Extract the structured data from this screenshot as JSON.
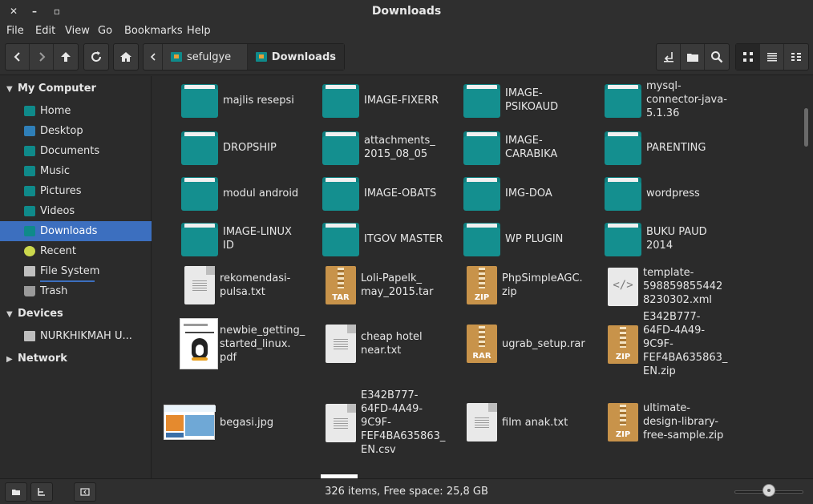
{
  "window": {
    "title": "Downloads"
  },
  "menu": [
    "File",
    "Edit",
    "View",
    "Go",
    "Bookmarks",
    "Help"
  ],
  "breadcrumb": [
    {
      "label": "sefulgye",
      "active": false
    },
    {
      "label": "Downloads",
      "active": true
    }
  ],
  "sidebar": {
    "sections": [
      {
        "label": "My Computer",
        "expanded": true
      },
      {
        "label": "Devices",
        "expanded": true
      },
      {
        "label": "Network",
        "expanded": false
      }
    ],
    "items": [
      {
        "label": "Home",
        "icon": "home-folder-icon"
      },
      {
        "label": "Desktop",
        "icon": "desktop-folder-icon"
      },
      {
        "label": "Documents",
        "icon": "documents-folder-icon"
      },
      {
        "label": "Music",
        "icon": "music-folder-icon"
      },
      {
        "label": "Pictures",
        "icon": "pictures-folder-icon"
      },
      {
        "label": "Videos",
        "icon": "videos-folder-icon"
      },
      {
        "label": "Downloads",
        "icon": "downloads-folder-icon",
        "selected": true
      },
      {
        "label": "Recent",
        "icon": "recent-icon"
      },
      {
        "label": "File System",
        "icon": "drive-icon"
      },
      {
        "label": "Trash",
        "icon": "trash-icon"
      }
    ],
    "devices": [
      {
        "label": "NURKHIKMAH U...",
        "icon": "usb-drive-icon"
      }
    ]
  },
  "files": [
    {
      "name": "majlis resepsi",
      "type": "folder"
    },
    {
      "name": "IMAGE-FIXERR",
      "type": "folder"
    },
    {
      "name": "IMAGE-\nPSIKOAUD",
      "type": "folder"
    },
    {
      "name": "mysql-\nconnector-java-\n5.1.36",
      "type": "folder"
    },
    {
      "name": "DROPSHIP",
      "type": "folder"
    },
    {
      "name": "attachments_\n2015_08_05",
      "type": "folder"
    },
    {
      "name": "IMAGE-\nCARABIKA",
      "type": "folder"
    },
    {
      "name": "PARENTING",
      "type": "folder"
    },
    {
      "name": "modul android",
      "type": "folder"
    },
    {
      "name": "IMAGE-OBATS",
      "type": "folder"
    },
    {
      "name": "IMG-DOA",
      "type": "folder"
    },
    {
      "name": "wordpress",
      "type": "folder"
    },
    {
      "name": "IMAGE-LINUX\nID",
      "type": "folder"
    },
    {
      "name": "ITGOV MASTER",
      "type": "folder"
    },
    {
      "name": "WP PLUGIN",
      "type": "folder"
    },
    {
      "name": "BUKU PAUD\n2014",
      "type": "folder"
    },
    {
      "name": "rekomendasi-\npulsa.txt",
      "type": "text"
    },
    {
      "name": "Loli-Papelk_\nmay_2015.tar",
      "type": "archive",
      "badge": "TAR"
    },
    {
      "name": "PhpSimpleAGC.\nzip",
      "type": "archive",
      "badge": "ZIP"
    },
    {
      "name": "template-\n598859855442\n8230302.xml",
      "type": "xml"
    },
    {
      "name": "newbie_getting_\nstarted_linux.\npdf",
      "type": "pdf"
    },
    {
      "name": "cheap hotel\nnear.txt",
      "type": "text"
    },
    {
      "name": "ugrab_setup.rar",
      "type": "archive",
      "badge": "RAR"
    },
    {
      "name": "E342B777-\n64FD-4A49-\n9C9F-\nFEF4BA635863_\nEN.zip",
      "type": "archive",
      "badge": "ZIP"
    },
    {
      "name": "begasi.jpg",
      "type": "image"
    },
    {
      "name": "E342B777-\n64FD-4A49-\n9C9F-\nFEF4BA635863_\nEN.csv",
      "type": "text"
    },
    {
      "name": "film anak.txt",
      "type": "text"
    },
    {
      "name": "ultimate-\ndesign-library-\nfree-sample.zip",
      "type": "archive",
      "badge": "ZIP"
    }
  ],
  "status": {
    "text": "326 items, Free space: 25,8 GB",
    "zoom": 0.5
  },
  "colors": {
    "accent": "#3c6fbf",
    "folder": "#148f8f",
    "archive": "#c8934a"
  }
}
